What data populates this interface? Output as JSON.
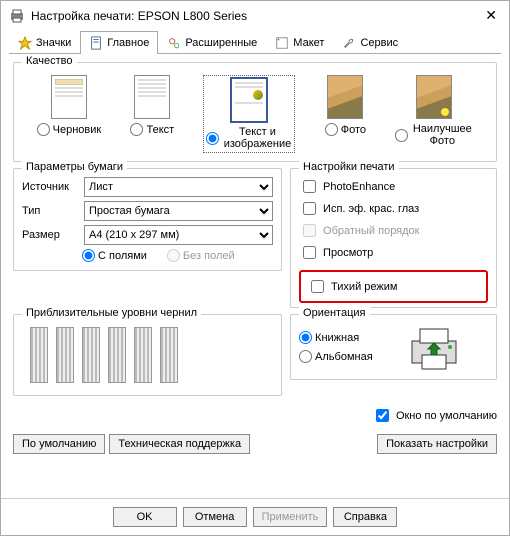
{
  "window": {
    "title": "Настройка печати: EPSON L800 Series"
  },
  "tabs": {
    "icons": "Значки",
    "main": "Главное",
    "advanced": "Расширенные",
    "layout": "Макет",
    "service": "Сервис"
  },
  "quality": {
    "label": "Качество",
    "draft": "Черновик",
    "text": "Текст",
    "text_image": "Текст и изображение",
    "photo": "Фото",
    "best_photo": "Наилучшее Фото"
  },
  "paper": {
    "label": "Параметры бумаги",
    "source_label": "Источник",
    "source_value": "Лист",
    "type_label": "Тип",
    "type_value": "Простая бумага",
    "size_label": "Размер",
    "size_value": "A4 (210 x 297 мм)",
    "with_margins": "С полями",
    "no_margins": "Без полей"
  },
  "print_settings": {
    "label": "Настройки печати",
    "photoenhance": "PhotoEnhance",
    "redeye": "Исп. эф. крас. глаз",
    "reverse": "Обратный порядок",
    "preview": "Просмотр",
    "quiet": "Тихий режим"
  },
  "ink": {
    "label": "Приблизительные уровни чернил"
  },
  "orientation": {
    "label": "Ориентация",
    "portrait": "Книжная",
    "landscape": "Альбомная"
  },
  "default_window": "Окно по умолчанию",
  "buttons": {
    "defaults": "По умолчанию",
    "tech_support": "Техническая поддержка",
    "show_settings": "Показать настройки",
    "ok": "OK",
    "cancel": "Отмена",
    "apply": "Применить",
    "help": "Справка"
  }
}
